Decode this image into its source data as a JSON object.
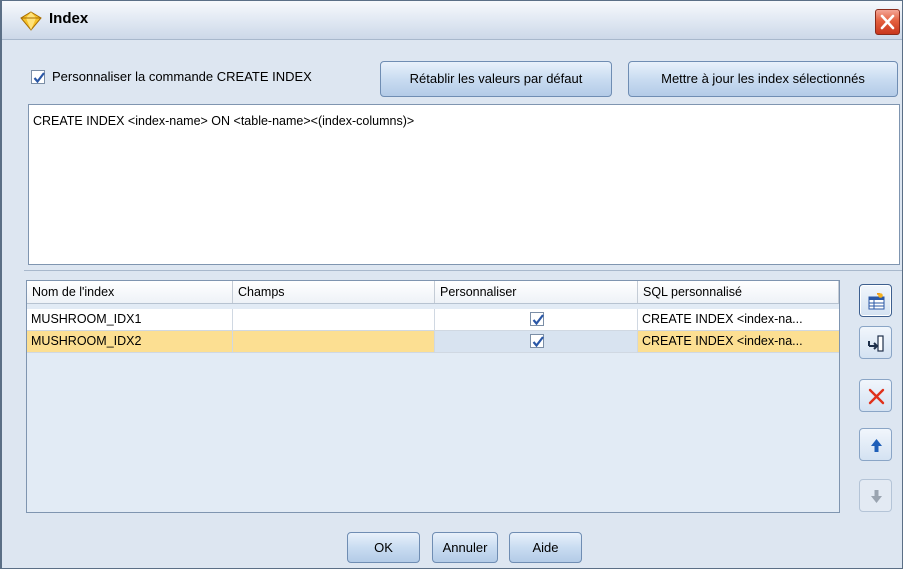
{
  "window": {
    "title": "Index"
  },
  "toolbar": {
    "customize_label": "Personnaliser la commande CREATE INDEX",
    "customize_checked": true,
    "reset_label": "Rétablir les valeurs par défaut",
    "update_label": "Mettre à jour les index sélectionnés"
  },
  "sql": {
    "text": "CREATE INDEX <index-name> ON <table-name><(index-columns)>"
  },
  "table": {
    "columns": [
      "Nom de l'index",
      "Champs",
      "Personnaliser",
      "SQL personnalisé"
    ],
    "rows": [
      {
        "name": "MUSHROOM_IDX1",
        "fields": "",
        "custom": true,
        "sql": "CREATE INDEX <index-na...",
        "selected": false
      },
      {
        "name": "MUSHROOM_IDX2",
        "fields": "",
        "custom": true,
        "sql": "CREATE INDEX <index-na...",
        "selected": true
      }
    ]
  },
  "side_buttons": [
    {
      "icon": "add-index-icon",
      "active": true
    },
    {
      "icon": "insert-row-icon"
    },
    {
      "icon": "delete-icon",
      "color": "#e0311b"
    },
    {
      "icon": "move-up-icon",
      "color": "#1f5fb8"
    },
    {
      "icon": "move-down-icon",
      "disabled": true
    }
  ],
  "footer": {
    "ok_label": "OK",
    "cancel_label": "Annuler",
    "help_label": "Aide"
  },
  "colors": {
    "selected_row": "#fcdf92",
    "accent": "#2a57a6"
  }
}
